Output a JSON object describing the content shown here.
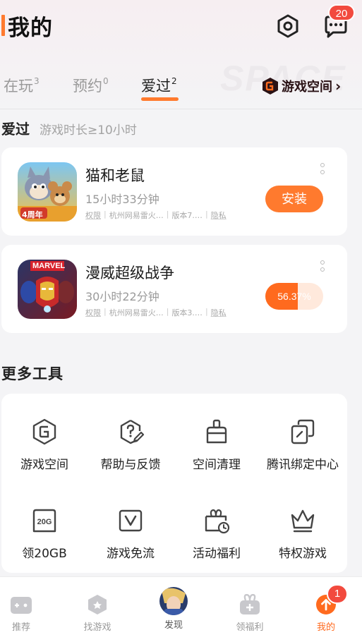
{
  "header": {
    "title": "我的",
    "message_badge": "20"
  },
  "tabs": {
    "items": [
      {
        "label": "在玩",
        "count": "3"
      },
      {
        "label": "预约",
        "count": "0"
      },
      {
        "label": "爱过",
        "count": "2"
      }
    ],
    "active": "爱过",
    "watermark": "SPACE",
    "space_link": "游戏空间"
  },
  "section": {
    "title": "爱过",
    "subtitle": "游戏时长≥10小时"
  },
  "games": [
    {
      "name": "猫和老鼠",
      "playtime": "15小时33分钟",
      "meta": [
        "权限",
        "杭州网易雷火…",
        "版本7.…",
        "隐私"
      ],
      "action": "安装",
      "icon": "tom-and-jerry-game-icon",
      "icon_badge": "4周年"
    },
    {
      "name": "漫威超级战争",
      "playtime": "30小时22分钟",
      "meta": [
        "权限",
        "杭州网易雷火…",
        "版本3.…",
        "隐私"
      ],
      "progress": "56.37%",
      "progress_value": 0.5637,
      "icon": "marvel-super-war-game-icon",
      "icon_badge": "MARVEL"
    }
  ],
  "tools": {
    "title": "更多工具",
    "items": [
      {
        "label": "游戏空间",
        "icon": "game-space-icon"
      },
      {
        "label": "帮助与反馈",
        "icon": "help-feedback-icon"
      },
      {
        "label": "空间清理",
        "icon": "cleanup-broom-icon"
      },
      {
        "label": "腾讯绑定中心",
        "icon": "tencent-bind-icon"
      },
      {
        "label": "领20GB",
        "icon": "data-20g-icon",
        "icon_text": "20G"
      },
      {
        "label": "游戏免流",
        "icon": "free-traffic-icon"
      },
      {
        "label": "活动福利",
        "icon": "activity-gift-icon"
      },
      {
        "label": "特权游戏",
        "icon": "crown-icon"
      }
    ]
  },
  "nav": {
    "items": [
      {
        "label": "推荐",
        "icon": "gamepad-icon"
      },
      {
        "label": "找游戏",
        "icon": "find-game-icon"
      },
      {
        "label": "发现",
        "icon": "discover-avatar-icon"
      },
      {
        "label": "领福利",
        "icon": "gift-icon"
      },
      {
        "label": "我的",
        "icon": "me-arrow-icon"
      }
    ],
    "active": "我的",
    "me_badge": "1"
  },
  "colors": {
    "accent": "#ff7a2e",
    "badge_red": "#f24a3e",
    "muted_text": "#9a9a9a"
  }
}
